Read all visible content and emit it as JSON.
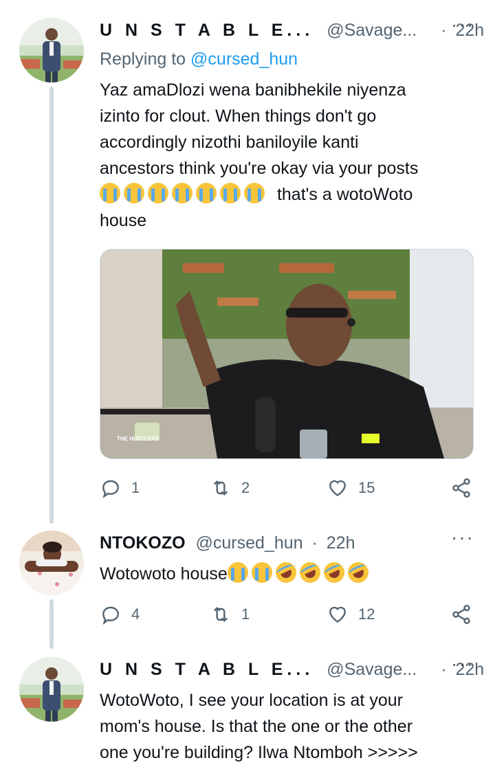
{
  "tweets": [
    {
      "name": "U N S T A B L E...",
      "handle": "@Savage...",
      "separator": "·",
      "time": "22h",
      "more": "···",
      "replying_prefix": "Replying to",
      "replying_to": "@cursed_hun",
      "text_lines": [
        "Yaz amaDlozi wena banibhekile niyenza",
        "izinto for clout. When things don't go",
        "accordingly nizothi baniloyile kanti",
        "ancestors think you're okay via your posts"
      ],
      "emoji_line_text": "that's a wotoWoto",
      "last_line": "house",
      "media_overlay_text": "THE HUSTLERS",
      "counts": {
        "reply": "1",
        "retweet": "2",
        "like": "15"
      }
    },
    {
      "name": "NTOKOZO",
      "handle": "@cursed_hun",
      "separator": "·",
      "time": "22h",
      "more": "···",
      "text": "Wotowoto house",
      "counts": {
        "reply": "4",
        "retweet": "1",
        "like": "12"
      }
    },
    {
      "name": "U N S T A B L E...",
      "handle": "@Savage...",
      "separator": "·",
      "time": "22h",
      "more": "···",
      "text_lines": [
        "WotoWoto, I see your location is at your",
        "mom's house. Is that the one or the other",
        "one you're building? Ilwa Ntomboh >>>>>"
      ]
    }
  ],
  "icons": [
    "reply-icon",
    "retweet-icon",
    "like-icon",
    "share-icon",
    "more-icon",
    "loudly-crying-face-emoji",
    "rolling-on-floor-laughing-emoji"
  ],
  "colors": {
    "link": "#1d9bf0",
    "secondary": "#536471",
    "thread_line": "#cfd9de"
  }
}
